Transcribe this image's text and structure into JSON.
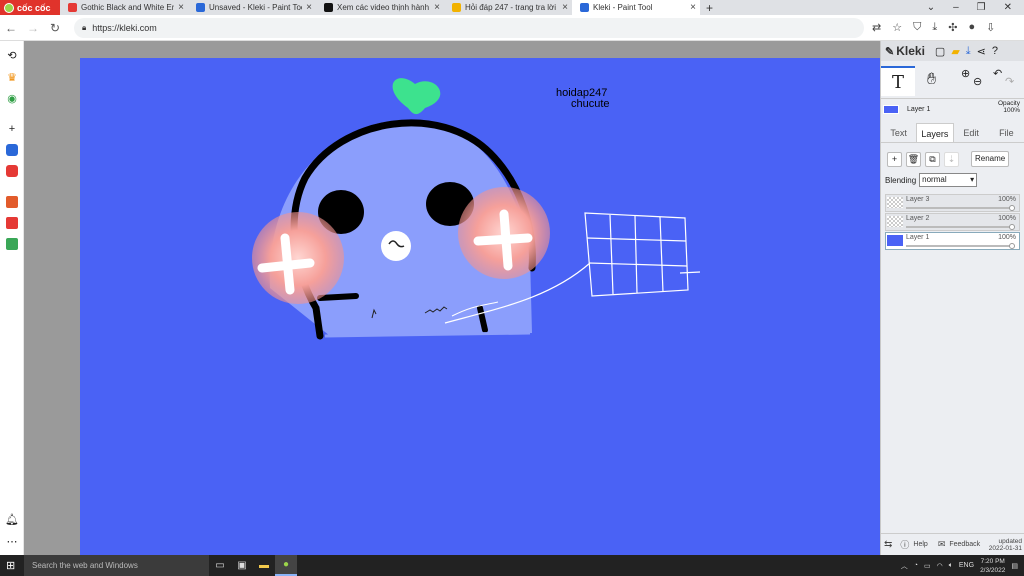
{
  "browser": {
    "brand": "cốc cốc",
    "tabs": [
      {
        "title": "Gothic Black and White Endi",
        "fav_color": "#e53935"
      },
      {
        "title": "Unsaved - Kleki - Paint Tool",
        "fav_color": "#2a68d8"
      },
      {
        "title": "Xem các video thịnh hành dà",
        "fav_color": "#111111"
      },
      {
        "title": "Hỏi đáp 247 - trang tra lời",
        "fav_color": "#f2b200"
      },
      {
        "title": "Kleki - Paint Tool",
        "fav_color": "#2a68d8"
      }
    ],
    "url": "https://kleki.com"
  },
  "canvas": {
    "background": "#4a62f5",
    "text_line1": "hoidap247",
    "text_line2": "chucute"
  },
  "panel": {
    "app_name": "Kleki",
    "active_layer_label": "Layer 1",
    "opacity_label": "Opacity",
    "opacity_value": "100%",
    "mode_tabs": [
      "Text",
      "Layers",
      "Edit",
      "File"
    ],
    "rename_label": "Rename",
    "blending_label": "Blending",
    "blending_value": "normal",
    "layers": [
      {
        "name": "Layer 3",
        "opacity": "100%"
      },
      {
        "name": "Layer 2",
        "opacity": "100%"
      },
      {
        "name": "Layer 1",
        "opacity": "100%"
      }
    ],
    "help_label": "Help",
    "feedback_label": "Feedback",
    "updated_label": "updated",
    "updated_date": "2022-01-31"
  },
  "taskbar": {
    "search_placeholder": "Search the web and Windows",
    "lang": "ENG",
    "time": "7:20 PM",
    "date": "2/3/2022"
  }
}
